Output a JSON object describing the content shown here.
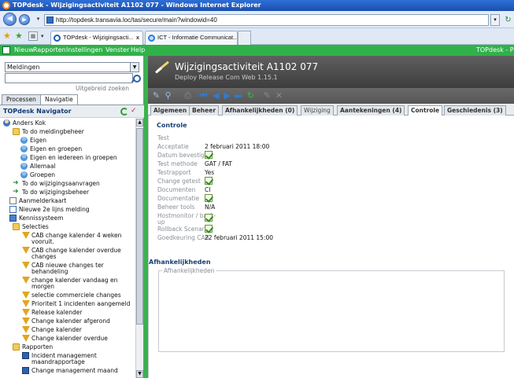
{
  "window": {
    "title": "TOPdesk - Wijzigingsactiviteit A1102 077 - Windows Internet Explorer"
  },
  "browser": {
    "url": "http://topdesk.transavia.loc/tas/secure/main?windowid=40",
    "tabs": [
      {
        "label": "TOPdesk - Wijzigingsacti...",
        "close": "x",
        "active": true
      },
      {
        "label": "ICT - Informatie Communicat...",
        "active": false
      }
    ]
  },
  "app_menu": {
    "items": [
      "Nieuw",
      "Rapporten",
      "Instellingen",
      "Venster",
      "Help"
    ],
    "right_label": "TOPdesk - Pr"
  },
  "left_panel": {
    "search_select": "Meldingen",
    "search_value": "",
    "advanced_search": "Uitgebreid zoeken",
    "tabs": [
      "Processen",
      "Navigatie"
    ],
    "active_tab": "Navigatie",
    "navigator_title": "TOPdesk Navigator",
    "tree": [
      {
        "label": "Anders Kok",
        "icon": "person"
      },
      {
        "label": "To do meldingbeheer",
        "icon": "folder"
      },
      {
        "label": "Eigen",
        "icon": "user"
      },
      {
        "label": "Eigen en groepen",
        "icon": "user"
      },
      {
        "label": "Eigen en iedereen in groepen",
        "icon": "user"
      },
      {
        "label": "Allemaal",
        "icon": "user"
      },
      {
        "label": "Groepen",
        "icon": "user"
      },
      {
        "label": "To do wijzigingsaanvragen",
        "icon": "arrow"
      },
      {
        "label": "To do wijzigingsbeheer",
        "icon": "arrow"
      },
      {
        "label": "Aanmelderkaart",
        "icon": "card"
      },
      {
        "label": "Nieuwe 2e lijns melding",
        "icon": "doc"
      },
      {
        "label": "Kennissysteem",
        "icon": "book"
      },
      {
        "label": "Selecties",
        "icon": "folder"
      },
      {
        "label": "CAB change kalender 4 weken",
        "label2": "vooruit.",
        "icon": "filter"
      },
      {
        "label": "CAB change kalender overdue",
        "label2": "changes",
        "icon": "filter"
      },
      {
        "label": "CAB nieuwe changes ter",
        "label2": "behandeling",
        "icon": "filter"
      },
      {
        "label": "change kalender vandaag en",
        "label2": "morgen",
        "icon": "filter"
      },
      {
        "label": "selectie commerciele changes",
        "icon": "filter"
      },
      {
        "label": "Prioriteit 1 incidenten aangemeld",
        "icon": "filter"
      },
      {
        "label": "Release kalender",
        "icon": "filter"
      },
      {
        "label": "Change kalender afgerond",
        "icon": "filter"
      },
      {
        "label": "Change kalender",
        "icon": "filter"
      },
      {
        "label": "Change kalender overdue",
        "icon": "filter"
      },
      {
        "label": "Rapporten",
        "icon": "folder"
      },
      {
        "label": "Incident management",
        "label2": "maandrapportage",
        "icon": "report"
      },
      {
        "label": "Change management maand",
        "icon": "report"
      }
    ]
  },
  "main": {
    "title": "Wijzigingsactiviteit A1102 077",
    "subtitle": "Deploy Release Com Web 1.15.1",
    "tabs": [
      {
        "label": "Algemeen"
      },
      {
        "label": "Beheer"
      },
      {
        "label": "Afhankelijkheden (0)"
      },
      {
        "label": "Wijziging",
        "dim": true
      },
      {
        "label": "Aantekeningen (4)"
      },
      {
        "label": "Controle",
        "active": true
      },
      {
        "label": "Geschiedenis (3)"
      }
    ],
    "section_controle": "Controle",
    "fields": [
      {
        "label": "Test",
        "value": ""
      },
      {
        "label": "Acceptatie",
        "value": "2 februari 2011 18:00"
      },
      {
        "label": "Datum bevestigd",
        "check": true
      },
      {
        "label": "Test methode",
        "value": "GAT / FAT"
      },
      {
        "label": "Testrapport",
        "value": "Yes"
      },
      {
        "label": "Change getest",
        "check": true
      },
      {
        "label": "Documenten",
        "value": "CI"
      },
      {
        "label": "Documentatie",
        "check": true
      },
      {
        "label": "Beheer tools",
        "value": "N/A"
      },
      {
        "label": "Hostmonitor / back-",
        "label2": "up",
        "check": true
      },
      {
        "label": "Rollback Scenario",
        "check": true
      },
      {
        "label": "Goedkeuring CAB",
        "value": "22 februari 2011 15:00"
      }
    ],
    "section_afhankelijkheden": "Afhankelijkheden",
    "fieldset_legend": "Afhankelijkheden"
  },
  "colors": {
    "accent_green": "#31b14a",
    "header_dark": "#4a4a4a",
    "ie_blue": "#1b4fae"
  }
}
